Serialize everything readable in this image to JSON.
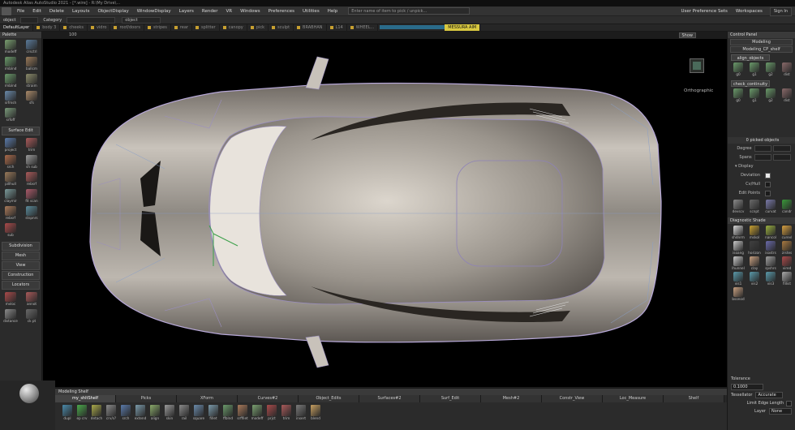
{
  "app": {
    "title": "Autodesk Alias AutoStudio 2021 - [*.wire] - R:\\My Drive\\..."
  },
  "menu": {
    "items": [
      "File",
      "Edit",
      "Delete",
      "Layouts",
      "ObjectDisplay",
      "WindowDisplay",
      "Layers",
      "Render",
      "VR",
      "Windows",
      "Preferences",
      "Utilities",
      "Help"
    ],
    "pick_placeholder": "Enter name of item to pick / unpick...",
    "user_pref_sets": "User Preference Sets",
    "workspaces": "Workspaces",
    "sign_in": "Sign In"
  },
  "filterbar": {
    "object_label": "object",
    "category_label": "Category",
    "object_value": "object",
    "category_value": ""
  },
  "layers": {
    "items": [
      "DefaultLayer",
      "body 3",
      "cheeks",
      "vidro",
      "roof/doors",
      "stripes",
      "rear",
      "splitter",
      "canopy",
      "pick",
      "sculpt",
      "BRABHAN",
      "L14",
      "WHEEL...",
      "MESSURA AIM"
    ],
    "accent": "#d8c840"
  },
  "viewport": {
    "zoom": "100",
    "show_label": "Show",
    "view_name": "Orthographic"
  },
  "palette": {
    "title": "Palette",
    "tools_top": [
      {
        "label": "modeff",
        "icon": "surface-icon",
        "color": "#7aa070"
      },
      {
        "label": "crsctrl",
        "icon": "curve-icon",
        "color": "#5a7a9a"
      },
      {
        "label": "rmblnd",
        "icon": "blend-icon",
        "color": "#6a9a6a"
      },
      {
        "label": "ballcm",
        "icon": "ball-icon",
        "color": "#9a7a5a"
      },
      {
        "label": "rmblnd",
        "icon": "blend-icon",
        "color": "#6a9a6a"
      },
      {
        "label": "straim",
        "icon": "stretch-icon",
        "color": "#8a8a6a"
      },
      {
        "label": "srfmsh",
        "icon": "mesh-icon",
        "color": "#6a8aaa"
      },
      {
        "label": "sfs",
        "icon": "sfs-icon",
        "color": "#aa8a6a"
      },
      {
        "label": "srfoff",
        "icon": "offset-icon",
        "color": "#7a9a7a"
      }
    ],
    "surface_edit": "Surface Edit",
    "tools_surface": [
      {
        "label": "project",
        "icon": "project-icon",
        "color": "#5a7aaa"
      },
      {
        "label": "trim",
        "icon": "trim-icon",
        "color": "#aa5a5a"
      },
      {
        "label": "srch",
        "icon": "search-icon",
        "color": "#aa6a4a"
      },
      {
        "label": "sh sub",
        "icon": "subdiv-icon",
        "color": "#9a9a9a"
      },
      {
        "label": "pillhull",
        "icon": "hull-icon",
        "color": "#9a7a5a"
      },
      {
        "label": "rebsrf",
        "icon": "rebuild-icon",
        "color": "#aa5a5a"
      },
      {
        "label": "claymir",
        "icon": "mirror-icon",
        "color": "#7a9a9a"
      },
      {
        "label": "fit scan",
        "icon": "scan-icon",
        "color": "#aa5a6a"
      },
      {
        "label": "rebsrf",
        "icon": "rebuild-icon",
        "color": "#aa7a5a"
      },
      {
        "label": "stspnrs",
        "icon": "spine-icon",
        "color": "#5a8a9a"
      },
      {
        "label": "sub",
        "icon": "sub-icon",
        "color": "#aa4a4a"
      }
    ],
    "sections": [
      "Subdivision",
      "Mesh",
      "View",
      "Construction",
      "Locators"
    ],
    "tools_locators": [
      {
        "label": "mvloc",
        "icon": "locator-icon",
        "color": "#aa4a4a"
      },
      {
        "label": "annot",
        "icon": "annotate-icon",
        "color": "#aa5a5a"
      },
      {
        "label": "distance",
        "icon": "distance-icon",
        "color": "#8a8a8a"
      },
      {
        "label": "ck pt",
        "icon": "checkpoint-icon",
        "color": "#6a6a6a"
      }
    ]
  },
  "control": {
    "title": "Control Panel",
    "mode": "Modeling",
    "workspace": "Modeling_CP_shelf",
    "align_tab": "align_objects",
    "align_tools": [
      {
        "label": "g0",
        "icon": "g0-icon",
        "color": "#6a9a6a"
      },
      {
        "label": "g1",
        "icon": "g1-icon",
        "color": "#6a9a6a"
      },
      {
        "label": "g2",
        "icon": "g2-icon",
        "color": "#6a9a6a"
      },
      {
        "label": "dist",
        "icon": "dist-icon",
        "color": "#8a6a6a"
      }
    ],
    "check_tab": "check_continuity",
    "check_tools": [
      {
        "label": "g0",
        "icon": "g0-icon",
        "color": "#6a9a6a"
      },
      {
        "label": "g1",
        "icon": "g1-icon",
        "color": "#6a9a6a"
      },
      {
        "label": "g2",
        "icon": "g2-icon",
        "color": "#6a9a6a"
      },
      {
        "label": "dist",
        "icon": "dist-icon",
        "color": "#8a6a6a"
      }
    ],
    "picked": "0 picked objects",
    "degree_label": "Degree",
    "spans_label": "Spans",
    "display_label": "Display",
    "deviation_label": "Deviation",
    "cvhull_label": "Cv/Hull",
    "editpoints_label": "Edit Points",
    "display_tools": [
      {
        "label": "devscv",
        "icon": "deviation-icon",
        "color": "#8a8a8a"
      },
      {
        "label": "scnpt",
        "icon": "scanpoint-icon",
        "color": "#6a6a6a"
      },
      {
        "label": "curvat",
        "icon": "curvature-icon",
        "color": "#7a7aaa"
      },
      {
        "label": "candr",
        "icon": "candr-icon",
        "color": "#3a9a3a"
      }
    ],
    "diag_title": "Diagnostic Shade",
    "diag_tools": [
      {
        "label": "shdnrm",
        "icon": "shade-icon",
        "color": "#d8d8d8"
      },
      {
        "label": "mskol",
        "icon": "mask-icon",
        "color": "#c8a030"
      },
      {
        "label": "nancol",
        "icon": "nan-icon",
        "color": "#9ab040"
      },
      {
        "label": "curevl",
        "icon": "curvature-eval-icon",
        "color": "#d8a040"
      },
      {
        "label": "isoang",
        "icon": "isoangle-icon",
        "color": "#c8c8c8"
      },
      {
        "label": "horizon",
        "icon": "horizon-icon",
        "color": "#404040"
      },
      {
        "label": "isostrs",
        "icon": "isostripes-icon",
        "color": "#6a6aaa"
      },
      {
        "label": "zrstes",
        "icon": "zebra-icon",
        "color": "#aa7a40"
      },
      {
        "label": "lhunnel",
        "icon": "tunnel-icon",
        "color": "#c8c8c8"
      },
      {
        "label": "clay",
        "icon": "clay-icon",
        "color": "#c8a080"
      },
      {
        "label": "spshrs",
        "icon": "sphere-icon",
        "color": "#a0a0a0"
      },
      {
        "label": "vired",
        "icon": "wire-icon",
        "color": "#aa4a4a"
      },
      {
        "label": "vis1",
        "icon": "vis1-icon",
        "color": "#5a9aaa"
      },
      {
        "label": "vis2",
        "icon": "vis2-icon",
        "color": "#5a9aaa"
      },
      {
        "label": "vis3",
        "icon": "vis3-icon",
        "color": "#5a9aaa"
      },
      {
        "label": "fillist",
        "icon": "fillist-icon",
        "color": "#aaaaaa"
      },
      {
        "label": "bsonod",
        "icon": "bsonod-icon",
        "color": "#c8a080"
      }
    ]
  },
  "props": {
    "tolerance_label": "Tolerance",
    "tolerance_value": "0.1000",
    "tessellator_label": "Tessellator",
    "tessellator_value": "Accurate",
    "limit_edge_label": "Limit Edge Length",
    "layer_label": "Layer",
    "layer_value": "None"
  },
  "shelf": {
    "title": "Modeling Shelf",
    "tabs": [
      "my_shltShelf",
      "Picks",
      "XForm",
      "Curves#2",
      "Object_Edits",
      "Surfaces#2",
      "Surf_Edit",
      "Mesh#2",
      "Constr_View",
      "Loc_Measure",
      "Shelf"
    ],
    "active_tab": 0,
    "tools": [
      {
        "label": "dupl",
        "icon": "duplicate-icon",
        "color": "#4a8aaa"
      },
      {
        "label": "ep crv",
        "icon": "ep-curve-icon",
        "color": "#4aaa4a"
      },
      {
        "label": "detach",
        "icon": "detach-icon",
        "color": "#aaaa4a"
      },
      {
        "label": "crv/s?",
        "icon": "curve-surface-icon",
        "color": "#8a8a8a"
      },
      {
        "label": "srch",
        "icon": "search-icon",
        "color": "#5a7aaa"
      },
      {
        "label": "extend",
        "icon": "extend-icon",
        "color": "#7a9aaa"
      },
      {
        "label": "align",
        "icon": "align-icon",
        "color": "#8aaa6a"
      },
      {
        "label": "skin",
        "icon": "skin-icon",
        "color": "#9a9a9a"
      },
      {
        "label": "rail",
        "icon": "rail-icon",
        "color": "#8a8a8a"
      },
      {
        "label": "square",
        "icon": "square-icon",
        "color": "#6a8aaa"
      },
      {
        "label": "fillet",
        "icon": "fillet-icon",
        "color": "#7a9aaa"
      },
      {
        "label": "ffblnd",
        "icon": "blend-icon",
        "color": "#6a9a6a"
      },
      {
        "label": "srffilet",
        "icon": "fillet-icon",
        "color": "#aa7a5a"
      },
      {
        "label": "modeff",
        "icon": "surface-icon",
        "color": "#7aa070"
      },
      {
        "label": "prjct",
        "icon": "project-icon",
        "color": "#aa4a4a"
      },
      {
        "label": "trim",
        "icon": "trim-icon",
        "color": "#aa5a5a"
      },
      {
        "label": "insert",
        "icon": "insert-icon",
        "color": "#7a7a7a"
      },
      {
        "label": "blend",
        "icon": "blend-icon",
        "color": "#c8a060"
      }
    ]
  }
}
